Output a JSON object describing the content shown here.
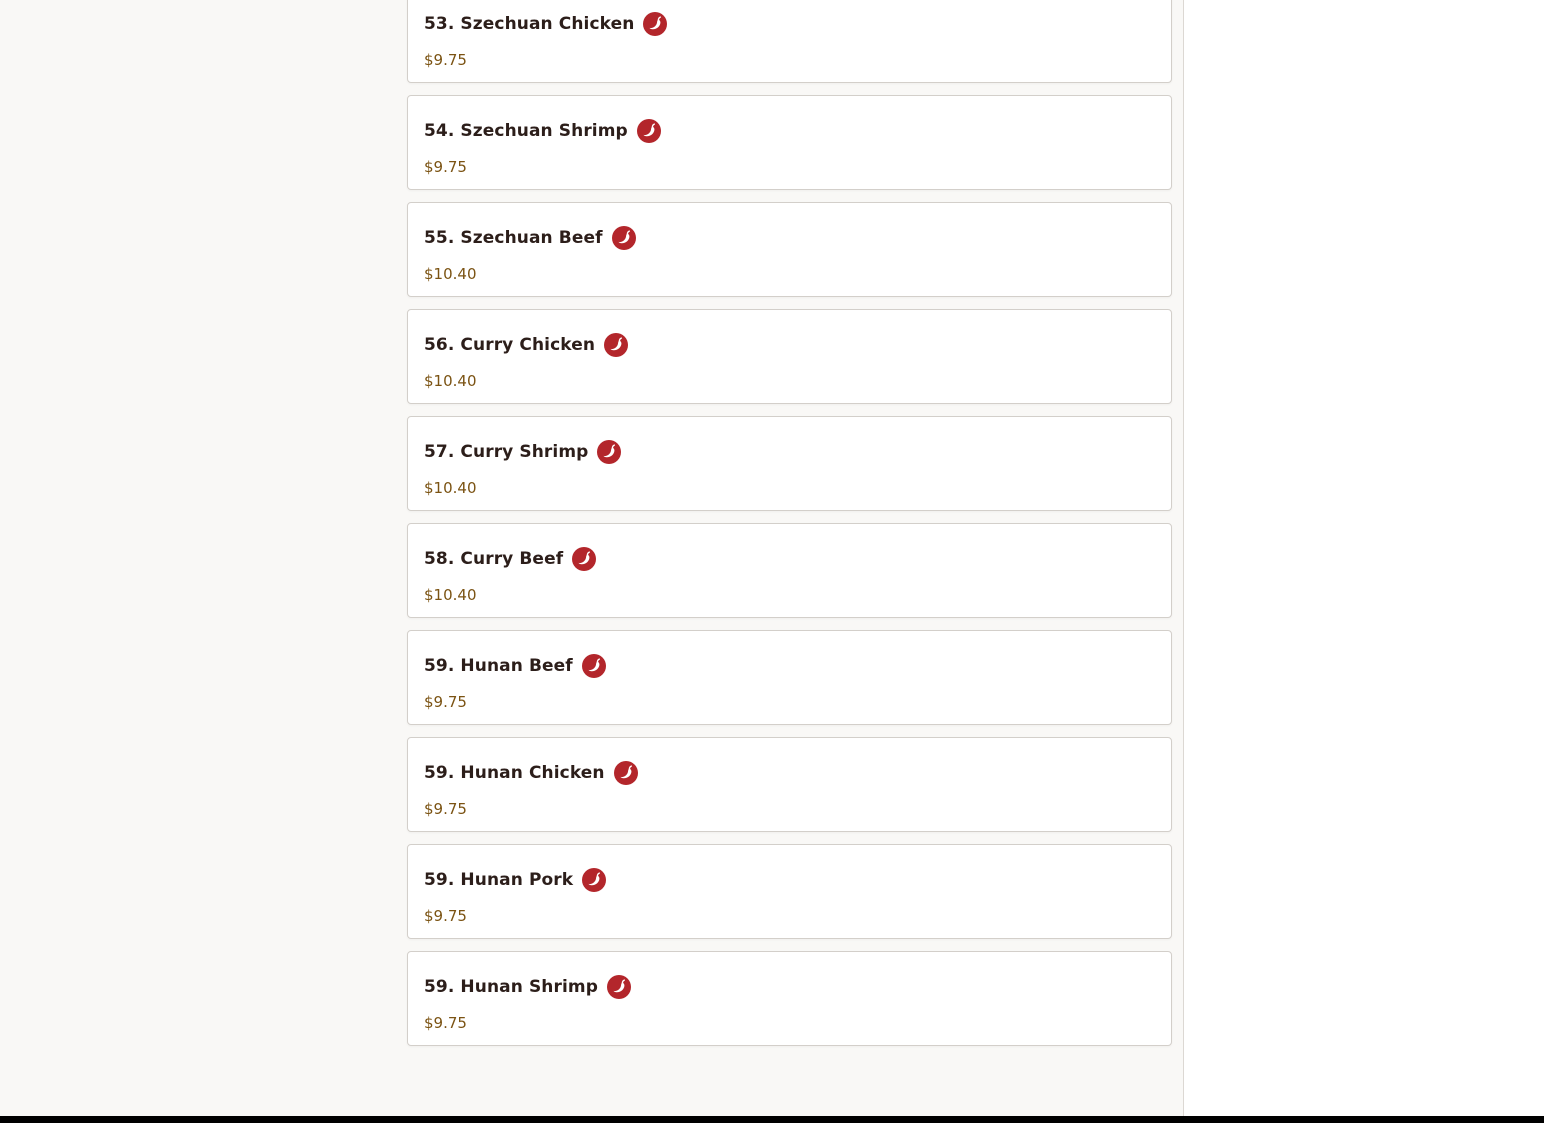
{
  "menu": {
    "items": [
      {
        "name": "53. Szechuan Chicken",
        "price": "$9.75",
        "icon": "spicy-pepper-icon"
      },
      {
        "name": "54. Szechuan Shrimp",
        "price": "$9.75",
        "icon": "spicy-pepper-icon"
      },
      {
        "name": "55. Szechuan Beef",
        "price": "$10.40",
        "icon": "spicy-pepper-icon"
      },
      {
        "name": "56. Curry Chicken",
        "price": "$10.40",
        "icon": "spicy-pepper-icon"
      },
      {
        "name": "57. Curry Shrimp",
        "price": "$10.40",
        "icon": "spicy-pepper-icon"
      },
      {
        "name": "58. Curry Beef",
        "price": "$10.40",
        "icon": "spicy-pepper-icon"
      },
      {
        "name": "59. Hunan Beef",
        "price": "$9.75",
        "icon": "spicy-pepper-icon"
      },
      {
        "name": "59. Hunan Chicken",
        "price": "$9.75",
        "icon": "spicy-pepper-icon"
      },
      {
        "name": "59. Hunan Pork",
        "price": "$9.75",
        "icon": "spicy-pepper-icon"
      },
      {
        "name": "59. Hunan Shrimp",
        "price": "$9.75",
        "icon": "spicy-pepper-icon"
      }
    ]
  },
  "colors": {
    "spicy_icon": "#b3262b",
    "price_text": "#7b5313",
    "item_title": "#2c1e1a",
    "page_background": "#f9f8f6"
  }
}
